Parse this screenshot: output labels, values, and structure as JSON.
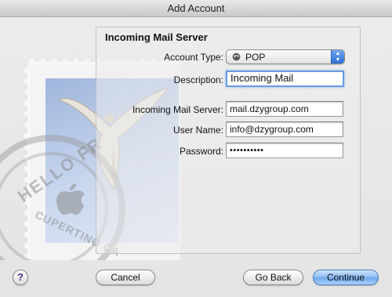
{
  "window": {
    "title": "Add Account"
  },
  "form": {
    "section_title": "Incoming Mail Server",
    "account_type": {
      "label": "Account Type:",
      "value": "POP",
      "icon": "globe-icon"
    },
    "description": {
      "label": "Description:",
      "value": "Incoming Mail"
    },
    "server": {
      "label": "Incoming Mail Server:",
      "value": "mail.dzygroup.com"
    },
    "username": {
      "label": "User Name:",
      "value": "info@dzygroup.com"
    },
    "password": {
      "label": "Password:",
      "value": "••••••••••"
    }
  },
  "buttons": {
    "help": "?",
    "cancel": "Cancel",
    "go_back": "Go Back",
    "continue": "Continue"
  },
  "decoration": {
    "postmark_line1": "HELLO FR",
    "postmark_line2": "CUPERTINO CA"
  },
  "colors": {
    "focus_ring": "#6a9be0",
    "default_button": "#6ea6ec"
  }
}
